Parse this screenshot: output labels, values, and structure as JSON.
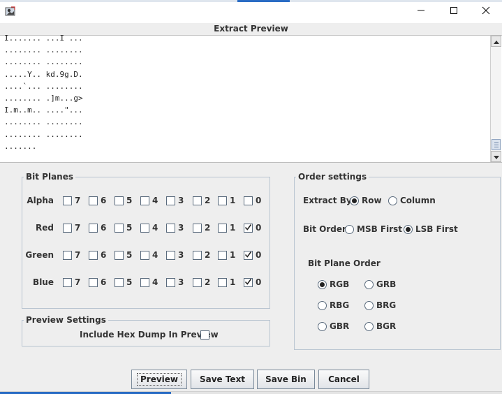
{
  "window": {
    "title": "Extract Preview",
    "controls": {
      "minimize": "minimize-icon",
      "maximize": "maximize-icon",
      "close": "close-icon"
    }
  },
  "preview": {
    "lines": [
      "I....... ...I ...",
      "........ ........",
      "........ ........",
      ".....Y.. kd.9g.D.",
      "....`... ........",
      "........ .]m...g>",
      "I.m..m.. ....\"...",
      "........ ........",
      "........ ........",
      "......."
    ]
  },
  "bit_planes": {
    "title": "Bit Planes",
    "bits": [
      "7",
      "6",
      "5",
      "4",
      "3",
      "2",
      "1",
      "0"
    ],
    "channels": [
      {
        "name": "Alpha",
        "checked": [
          false,
          false,
          false,
          false,
          false,
          false,
          false,
          false
        ]
      },
      {
        "name": "Red",
        "checked": [
          false,
          false,
          false,
          false,
          false,
          false,
          false,
          true
        ]
      },
      {
        "name": "Green",
        "checked": [
          false,
          false,
          false,
          false,
          false,
          false,
          false,
          true
        ]
      },
      {
        "name": "Blue",
        "checked": [
          false,
          false,
          false,
          false,
          false,
          false,
          false,
          true
        ]
      }
    ]
  },
  "preview_settings": {
    "title": "Preview Settings",
    "hex_dump_label": "Include Hex Dump In Preview",
    "hex_dump_checked": false
  },
  "order_settings": {
    "title": "Order settings",
    "extract_by": {
      "label": "Extract By",
      "options": [
        "Row",
        "Column"
      ],
      "selected": "Row"
    },
    "bit_order": {
      "label": "Bit Order",
      "options": [
        "MSB First",
        "LSB First"
      ],
      "selected": "LSB First"
    },
    "bit_plane_order": {
      "label": "Bit Plane Order",
      "options": [
        "RGB",
        "GRB",
        "RBG",
        "BRG",
        "GBR",
        "BGR"
      ],
      "selected": "RGB"
    }
  },
  "buttons": {
    "preview": "Preview",
    "save_text": "Save Text",
    "save_bin": "Save Bin",
    "cancel": "Cancel"
  },
  "colors": {
    "accent": "#2a6cc4",
    "background": "#eeeeee",
    "group_border": "#b8c4d0"
  }
}
